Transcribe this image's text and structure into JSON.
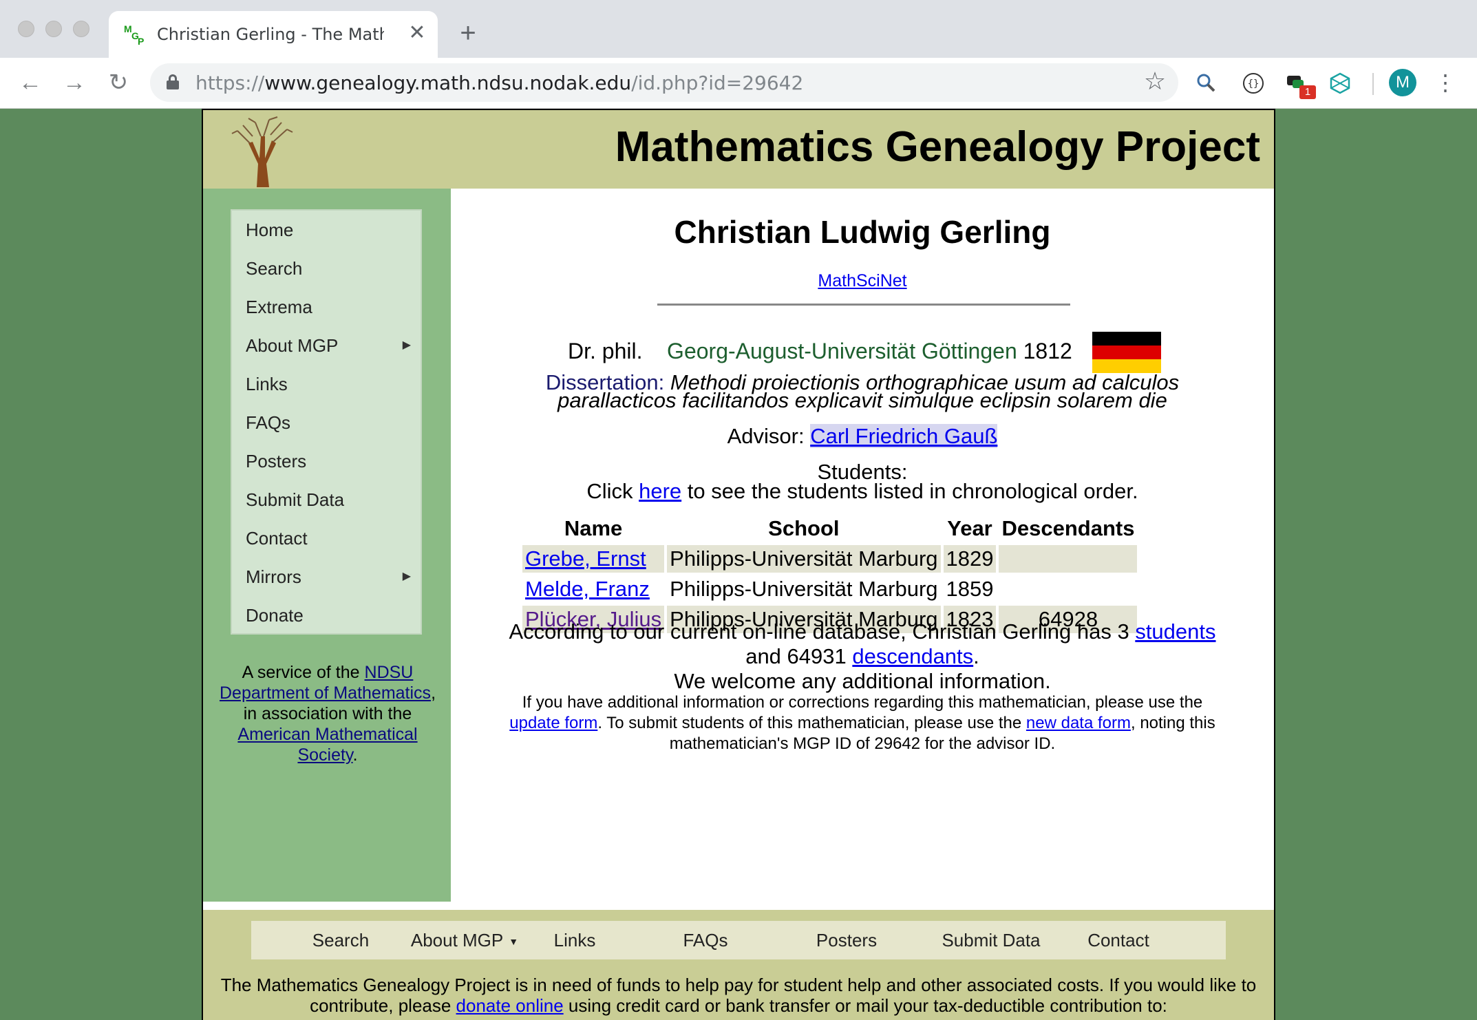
{
  "browser": {
    "tab_title": "Christian Gerling - The Mathem",
    "url_scheme": "https://",
    "url_host": "www.genealogy.math.ndsu.nodak.edu",
    "url_path": "/id.php?id=29642",
    "extension_badge": "1",
    "avatar_letter": "M"
  },
  "banner": {
    "title": "Mathematics Genealogy Project"
  },
  "sidebar": {
    "items": [
      {
        "label": "Home",
        "submenu": false
      },
      {
        "label": "Search",
        "submenu": false
      },
      {
        "label": "Extrema",
        "submenu": false
      },
      {
        "label": "About MGP",
        "submenu": true
      },
      {
        "label": "Links",
        "submenu": false
      },
      {
        "label": "FAQs",
        "submenu": false
      },
      {
        "label": "Posters",
        "submenu": false
      },
      {
        "label": "Submit Data",
        "submenu": false
      },
      {
        "label": "Contact",
        "submenu": false
      },
      {
        "label": "Mirrors",
        "submenu": true
      },
      {
        "label": "Donate",
        "submenu": false
      }
    ],
    "service": {
      "t1": "A service of the ",
      "link1": "NDSU Department of Mathematics",
      "t2": ", in association with the ",
      "link2": "American Mathematical Society",
      "t3": "."
    }
  },
  "person": {
    "name": "Christian Ludwig Gerling",
    "mathscinet": "MathSciNet",
    "degree": "Dr. phil.",
    "school": "Georg-August-Universität Göttingen",
    "year": "1812",
    "flag_colors": [
      "#000000",
      "#dd0000",
      "#ffce00"
    ],
    "dissertation_label": "Dissertation:",
    "dissertation_line1": "Methodi proiectionis orthographicae usum ad calculos",
    "dissertation_line2": "parallacticos facilitandos explicavit simulque eclipsin solarem die",
    "advisor_label": "Advisor:",
    "advisor_name": "Carl Friedrich Gauß"
  },
  "students": {
    "heading": "Students:",
    "click_pre": "Click ",
    "click_link": "here",
    "click_post": " to see the students listed in chronological order.",
    "columns": [
      "Name",
      "School",
      "Year",
      "Descendants"
    ],
    "rows": [
      {
        "name": "Grebe, Ernst",
        "school": "Philipps-Universität Marburg",
        "year": "1829",
        "descendants": "",
        "visited": false
      },
      {
        "name": "Melde, Franz",
        "school": "Philipps-Universität Marburg",
        "year": "1859",
        "descendants": "",
        "visited": false
      },
      {
        "name": "Plücker, Julius",
        "school": "Philipps-Universität Marburg",
        "year": "1823",
        "descendants": "64928",
        "visited": true
      }
    ]
  },
  "summary": {
    "pre": "According to our current on-line database, Christian Gerling has 3 ",
    "students_link": "students",
    "mid": "and 64931 ",
    "descendants_link": "descendants",
    "end": ".",
    "welcome": "We welcome any additional information."
  },
  "note": {
    "t1": "If you have additional information or corrections regarding this mathematician, please use the",
    "update_link": "update form",
    "t2": ". To submit students of this mathematician, please use the ",
    "new_link": "new data form",
    "t3": ", noting this",
    "t4": "mathematician's MGP ID of 29642 for the advisor ID."
  },
  "footer": {
    "nav": [
      "Search",
      "About MGP",
      "Links",
      "FAQs",
      "Posters",
      "Submit Data",
      "Contact"
    ],
    "fund_t1": "The Mathematics Genealogy Project is in need of funds to help pay for student help and other associated costs. If you would like to",
    "fund_t2": "contribute, please ",
    "fund_link": "donate online",
    "fund_t3": " using credit card or bank transfer or mail your tax-deductible contribution to:"
  }
}
